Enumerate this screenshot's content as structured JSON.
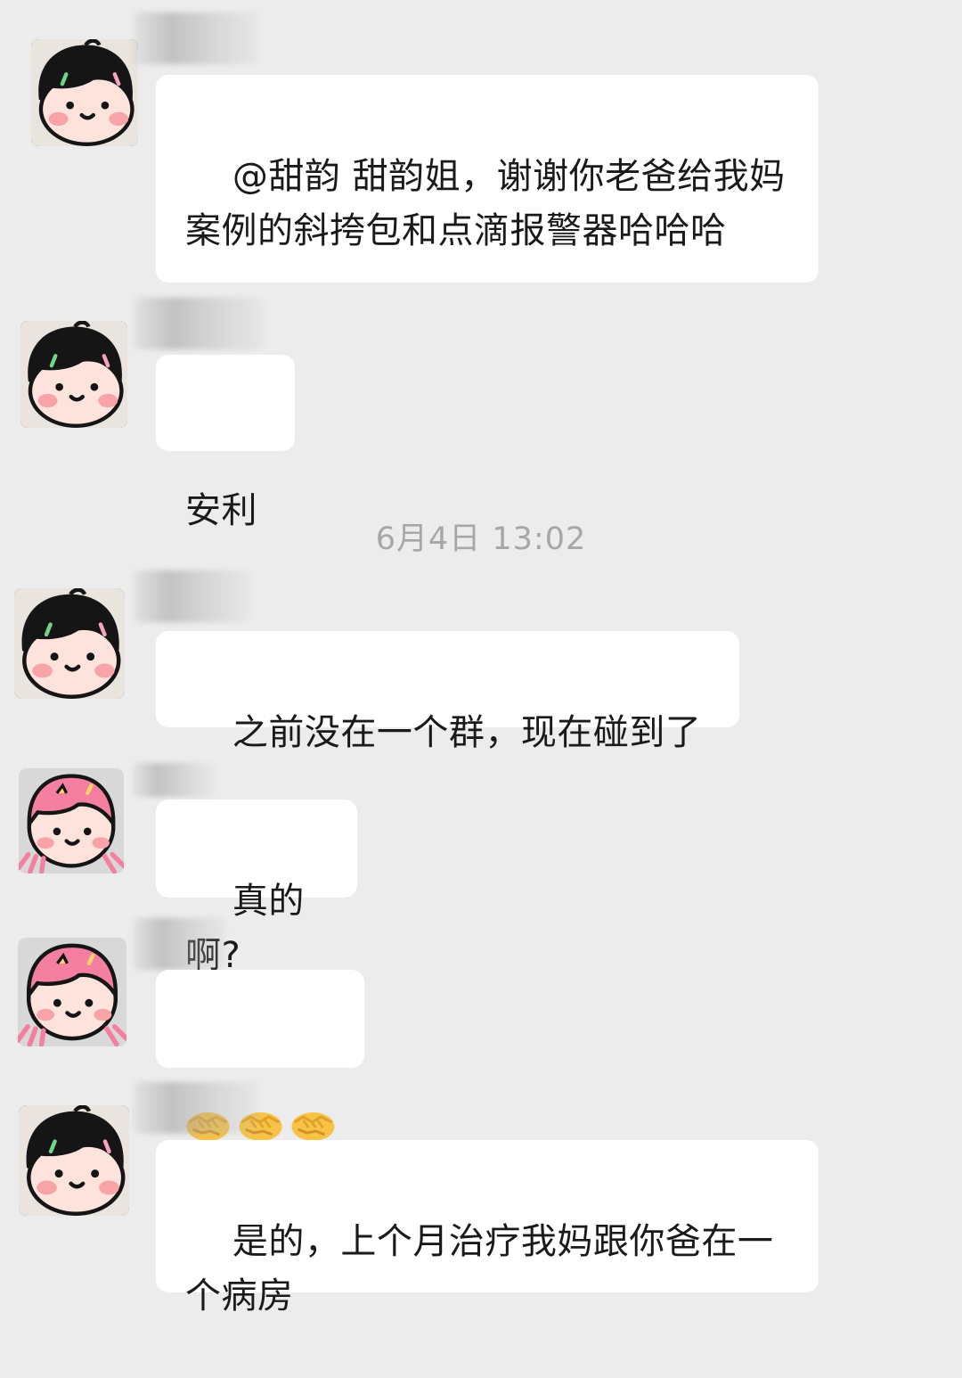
{
  "timestamp": "6月4日 13:02",
  "messages": [
    {
      "text": "@甜韵 甜韵姐，谢谢你老爸给我妈案例的斜挎包和点滴报警器哈哈哈",
      "avatar": "black-hair-avatar"
    },
    {
      "text": "安利",
      "avatar": "black-hair-avatar"
    },
    {
      "text": "之前没在一个群，现在碰到了",
      "avatar": "black-hair-avatar"
    },
    {
      "text": "真的啊?",
      "avatar": "pink-hair-avatar"
    },
    {
      "emojis": [
        "handshake-emoji",
        "handshake-emoji",
        "handshake-emoji"
      ],
      "avatar": "pink-hair-avatar"
    },
    {
      "text": "是的，上个月治疗我妈跟你爸在一个病房",
      "avatar": "black-hair-avatar"
    }
  ],
  "colors": {
    "background": "#ececec",
    "bubble": "#ffffff",
    "text": "#1a1a1a",
    "timestamp": "#a7a7a7",
    "skin": "#fde3dc",
    "blush": "#f7a3a8",
    "black_hair": "#151515",
    "pink_hair": "#f47fa0"
  }
}
